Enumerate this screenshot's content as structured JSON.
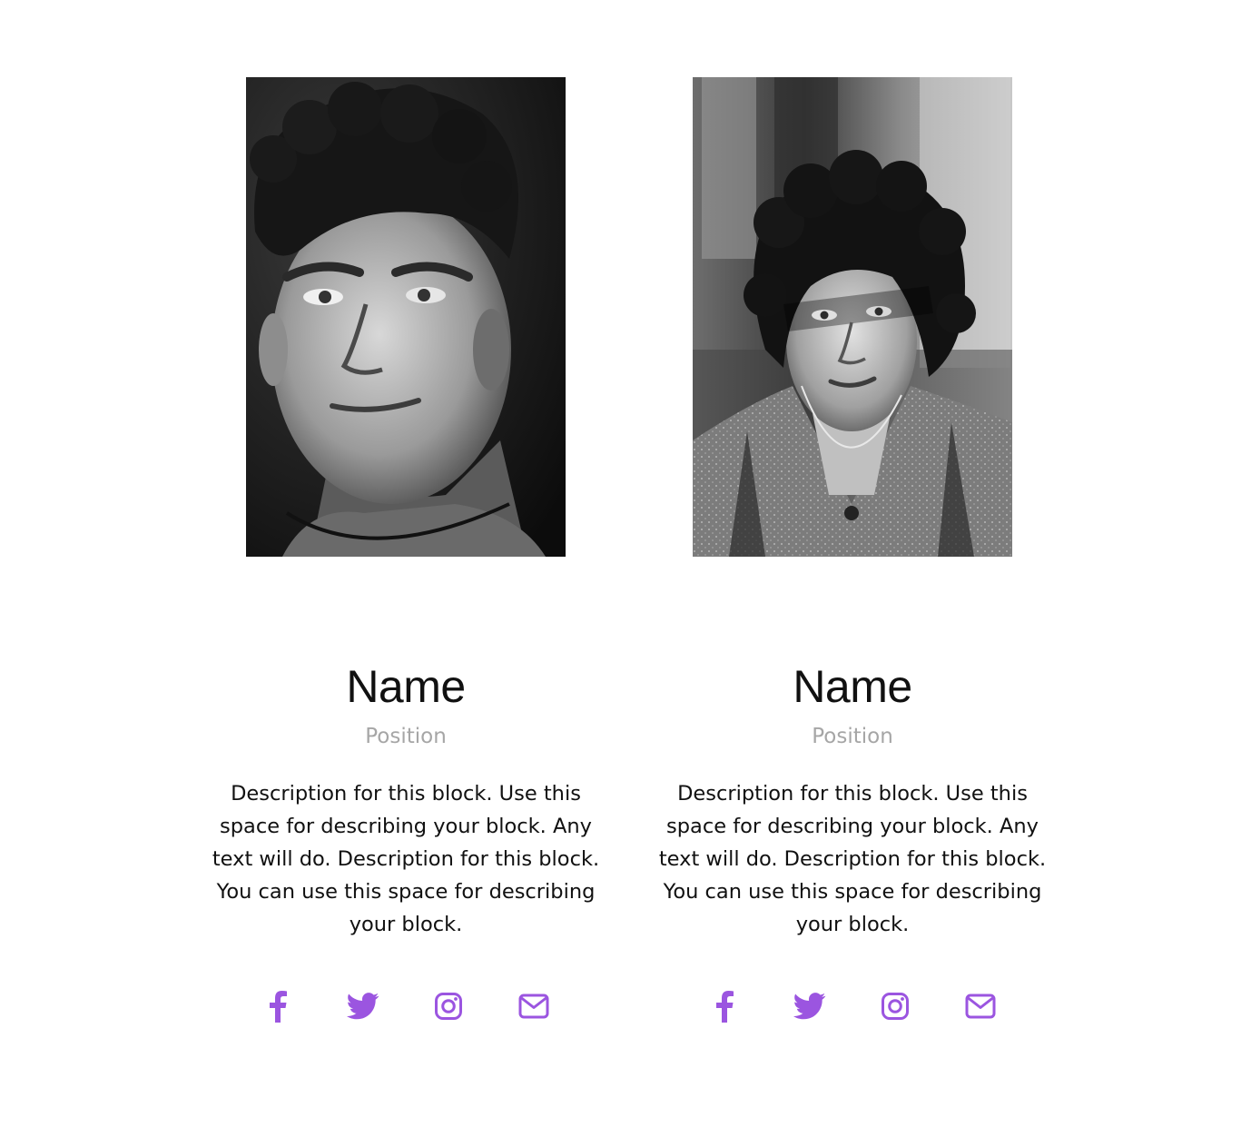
{
  "theme": {
    "accent": "#9b55e0",
    "text": "#111111",
    "muted": "#a6a6a6",
    "background": "#ffffff"
  },
  "members": [
    {
      "photo_desc": "portrait-man-curly-hair",
      "name": "Name",
      "position": "Position",
      "description": "Description for this block. Use this space for describing your block. Any text will do. Description for this block. You can use this space for describing your block.",
      "social": [
        {
          "icon": "facebook-icon"
        },
        {
          "icon": "twitter-icon"
        },
        {
          "icon": "instagram-icon"
        },
        {
          "icon": "email-icon"
        }
      ]
    },
    {
      "photo_desc": "portrait-person-wavy-hair",
      "name": "Name",
      "position": "Position",
      "description": "Description for this block. Use this space for describing your block. Any text will do. Description for this block. You can use this space for describing your block.",
      "social": [
        {
          "icon": "facebook-icon"
        },
        {
          "icon": "twitter-icon"
        },
        {
          "icon": "instagram-icon"
        },
        {
          "icon": "email-icon"
        }
      ]
    }
  ]
}
